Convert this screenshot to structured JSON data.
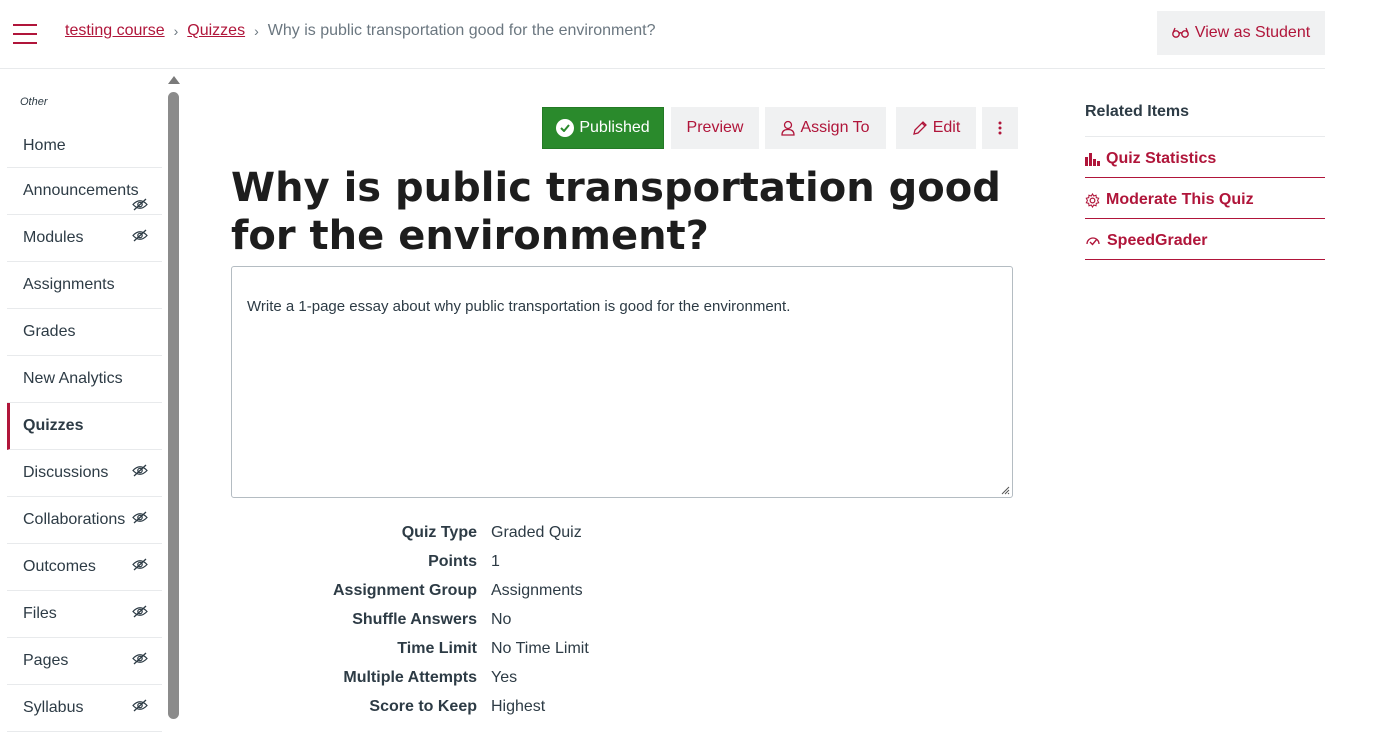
{
  "header": {
    "breadcrumb": {
      "course": "testing course",
      "section": "Quizzes",
      "current": "Why is public transportation good for the environment?"
    },
    "view_as_student_label": "View as Student"
  },
  "sidebar": {
    "section_label": "Other",
    "items": [
      {
        "label": "Home",
        "hidden": false
      },
      {
        "label": "Announcements",
        "hidden": true
      },
      {
        "label": "Modules",
        "hidden": true
      },
      {
        "label": "Assignments",
        "hidden": false
      },
      {
        "label": "Grades",
        "hidden": false
      },
      {
        "label": "New Analytics",
        "hidden": false
      },
      {
        "label": "Quizzes",
        "hidden": false,
        "active": true
      },
      {
        "label": "Discussions",
        "hidden": true
      },
      {
        "label": "Collaborations",
        "hidden": true
      },
      {
        "label": "Outcomes",
        "hidden": true
      },
      {
        "label": "Files",
        "hidden": true
      },
      {
        "label": "Pages",
        "hidden": true
      },
      {
        "label": "Syllabus",
        "hidden": true
      }
    ]
  },
  "toolbar": {
    "published_label": "Published",
    "preview_label": "Preview",
    "assign_label": "Assign To",
    "edit_label": "Edit"
  },
  "quiz": {
    "title": "Why is public transportation good for the environment?",
    "description": "Write a 1-page essay about why public transportation is good for the environment.",
    "details": [
      {
        "label": "Quiz Type",
        "value": "Graded Quiz"
      },
      {
        "label": "Points",
        "value": "1"
      },
      {
        "label": "Assignment Group",
        "value": "Assignments"
      },
      {
        "label": "Shuffle Answers",
        "value": "No"
      },
      {
        "label": "Time Limit",
        "value": "No Time Limit"
      },
      {
        "label": "Multiple Attempts",
        "value": "Yes"
      },
      {
        "label": "Score to Keep",
        "value": "Highest"
      }
    ]
  },
  "related": {
    "heading": "Related Items",
    "items": [
      {
        "label": "Quiz Statistics",
        "icon": "bar-chart-icon"
      },
      {
        "label": "Moderate This Quiz",
        "icon": "gear-icon"
      },
      {
        "label": "SpeedGrader",
        "icon": "speedgrader-icon"
      }
    ]
  },
  "colors": {
    "brand": "#b0153a",
    "published": "#2a8a2c",
    "text": "#2d3b45"
  }
}
